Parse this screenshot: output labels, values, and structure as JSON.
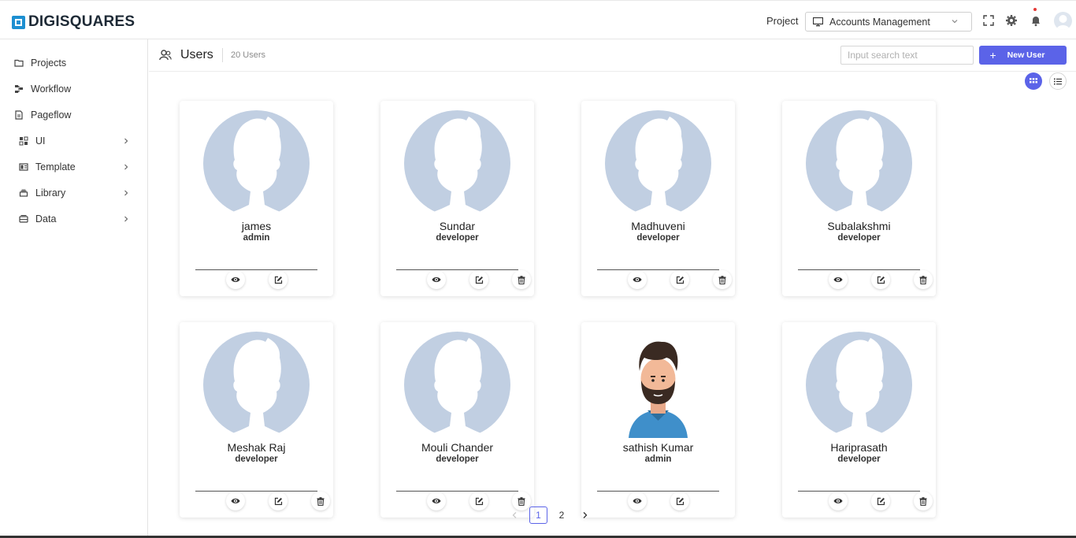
{
  "app": {
    "logo_text": "DIGISQUARES"
  },
  "topbar": {
    "project_label": "Project",
    "project_value": "Accounts Management",
    "icons": [
      "monitor-icon",
      "fullscreen-icon",
      "gear-icon",
      "bell-icon",
      "user-avatar"
    ]
  },
  "sidebar": {
    "items": [
      {
        "label": "Projects",
        "icon": "folder-icon",
        "expandable": false
      },
      {
        "label": "Workflow",
        "icon": "workflow-icon",
        "expandable": false
      },
      {
        "label": "Pageflow",
        "icon": "page-icon",
        "expandable": false
      },
      {
        "label": "UI",
        "icon": "grid-icon",
        "expandable": true
      },
      {
        "label": "Template",
        "icon": "template-icon",
        "expandable": true
      },
      {
        "label": "Library",
        "icon": "library-icon",
        "expandable": true
      },
      {
        "label": "Data",
        "icon": "database-icon",
        "expandable": true
      }
    ]
  },
  "header": {
    "title": "Users",
    "count": "20 Users",
    "search_placeholder": "Input search text",
    "new_user_label": "New User"
  },
  "users": [
    {
      "name": "james",
      "role": "admin",
      "photo": false,
      "actions": [
        "view",
        "edit"
      ]
    },
    {
      "name": "Sundar",
      "role": "developer",
      "photo": false,
      "actions": [
        "view",
        "edit",
        "delete"
      ]
    },
    {
      "name": "Madhuveni",
      "role": "developer",
      "photo": false,
      "actions": [
        "view",
        "edit",
        "delete"
      ]
    },
    {
      "name": "Subalakshmi",
      "role": "developer",
      "photo": false,
      "actions": [
        "view",
        "edit",
        "delete"
      ]
    },
    {
      "name": "Meshak Raj",
      "role": "developer",
      "photo": false,
      "actions": [
        "view",
        "edit",
        "delete"
      ]
    },
    {
      "name": "Mouli Chander",
      "role": "developer",
      "photo": false,
      "actions": [
        "view",
        "edit",
        "delete"
      ]
    },
    {
      "name": "sathish Kumar",
      "role": "admin",
      "photo": true,
      "actions": [
        "view",
        "edit"
      ]
    },
    {
      "name": "Hariprasath",
      "role": "developer",
      "photo": false,
      "actions": [
        "view",
        "edit",
        "delete"
      ]
    }
  ],
  "pagination": {
    "pages": [
      "1",
      "2"
    ],
    "current": "1"
  },
  "colors": {
    "accent": "#5b63e8",
    "avatar_bg": "#c1cfe2",
    "logo": "#1d8fd1"
  }
}
